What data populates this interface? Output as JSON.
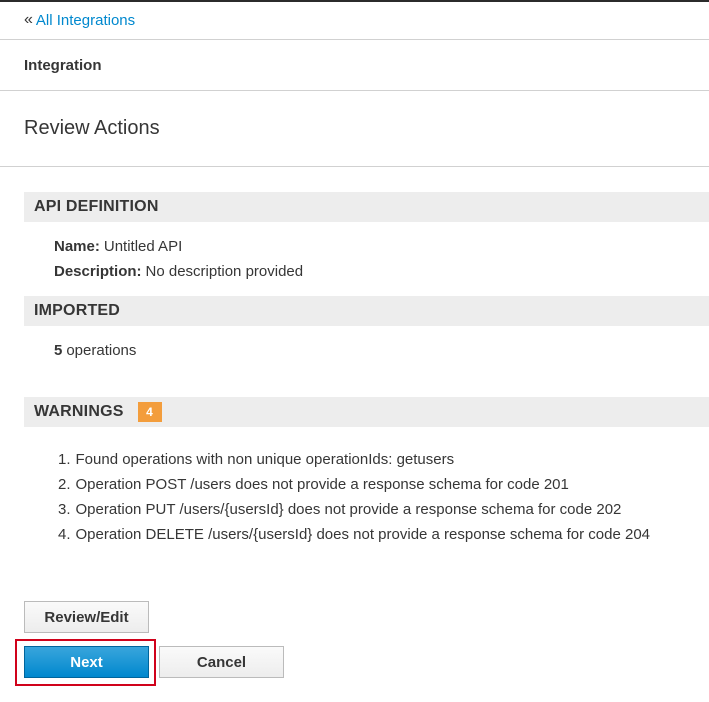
{
  "breadcrumb": {
    "back_icon": "double-chevron-left-icon",
    "back_label": "All Integrations"
  },
  "section": {
    "title": "Integration"
  },
  "page": {
    "title": "Review Actions"
  },
  "api_definition": {
    "header": "API DEFINITION",
    "name_label": "Name:",
    "name_value": "Untitled API",
    "description_label": "Description:",
    "description_value": "No description provided"
  },
  "imported": {
    "header": "IMPORTED",
    "count": "5",
    "count_label": "operations"
  },
  "warnings": {
    "header": "WARNINGS",
    "badge_count": "4",
    "badge_color": "#f39d3c",
    "items": [
      {
        "num": "1.",
        "text": "Found operations with non unique operationIds: getusers"
      },
      {
        "num": "2.",
        "text": "Operation POST /users does not provide a response schema for code 201"
      },
      {
        "num": "3.",
        "text": "Operation PUT /users/{usersId} does not provide a response schema for code 202"
      },
      {
        "num": "4.",
        "text": "Operation DELETE /users/{usersId} does not provide a response schema for code 204"
      }
    ]
  },
  "actions": {
    "review_edit_label": "Review/Edit",
    "next_label": "Next",
    "cancel_label": "Cancel",
    "primary_color": "#0088ce",
    "highlight_color": "#d0021b"
  }
}
